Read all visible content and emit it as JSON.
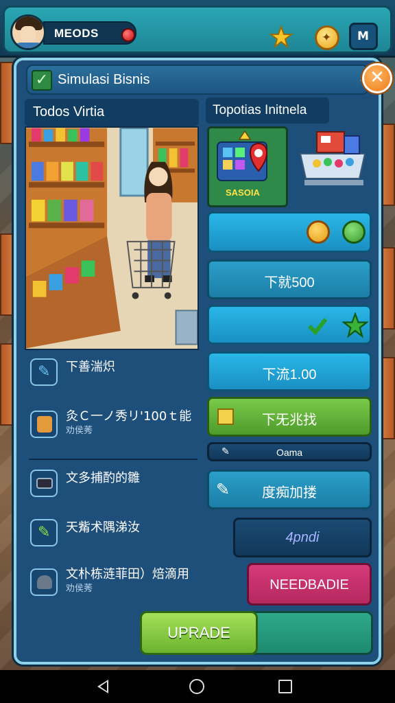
{
  "topbar": {
    "player_name": "MEODS",
    "menu_label": "M"
  },
  "panel": {
    "title": "Simulasi Bisnis",
    "close_label": "✕",
    "left_heading": "Todos Virtia",
    "right_heading": "Topotias Initnela",
    "feature_card_label": "SASOIA"
  },
  "buttons": {
    "price_1": "下就500",
    "price_2": "下流1.00",
    "green_action": "下旡兆找",
    "small_label": "Oama",
    "action_4": "度痴加搂",
    "amount": "4pndi",
    "needbadie": "NEEDBADIE",
    "upgrade": "UPRADE"
  },
  "list": [
    {
      "title": "下善湍炽",
      "subtitle": ""
    },
    {
      "title": "灸Ｃ一ノ秀リ'100ｔ能",
      "subtitle": "劝侯莠"
    },
    {
      "title": "文多捕酌的雛",
      "subtitle": ""
    },
    {
      "title": "天觜术隅涕汝",
      "subtitle": ""
    },
    {
      "title": "文朴栋涟菲田）焙滴用",
      "subtitle": "劝侯莠"
    }
  ],
  "colors": {
    "panel_bg": "#1e4f7a",
    "accent_cyan": "#29b7e8",
    "accent_green": "#79c94a",
    "accent_pink": "#d63a7a",
    "close_orange": "#ef7c16"
  }
}
